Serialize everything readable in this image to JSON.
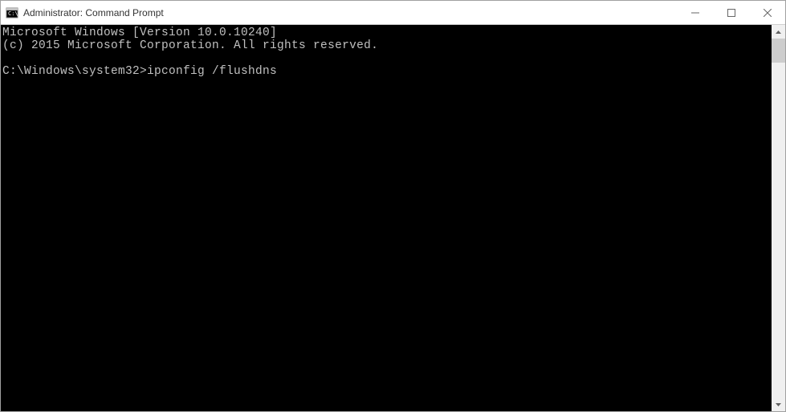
{
  "window": {
    "title": "Administrator: Command Prompt"
  },
  "terminal": {
    "line1": "Microsoft Windows [Version 10.0.10240]",
    "line2": "(c) 2015 Microsoft Corporation. All rights reserved.",
    "blank": "",
    "prompt": "C:\\Windows\\system32>",
    "command": "ipconfig /flushdns"
  }
}
